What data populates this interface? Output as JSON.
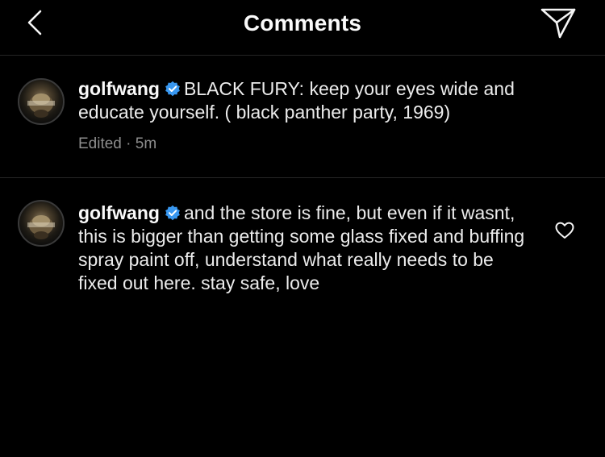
{
  "header": {
    "title": "Comments",
    "back_icon": "chevron-left-icon",
    "share_icon": "paper-plane-icon"
  },
  "comments": [
    {
      "username": "golfwang",
      "verified": true,
      "text": "BLACK FURY: keep your eyes wide and educate yourself. ( black panther party, 1969)",
      "edited_label": "Edited",
      "separator": "·",
      "time": "5m"
    },
    {
      "username": "golfwang",
      "verified": true,
      "text": "and the store is fine, but even if it wasnt, this is bigger than getting some glass fixed and buffing spray paint off, understand what really needs to be fixed out here. stay safe, love",
      "like_icon": "heart-outline-icon"
    }
  ],
  "colors": {
    "background": "#000000",
    "text": "#f5f5f5",
    "meta": "#8e8e8e",
    "divider": "#262626",
    "verified_badge": "#3897f0"
  }
}
